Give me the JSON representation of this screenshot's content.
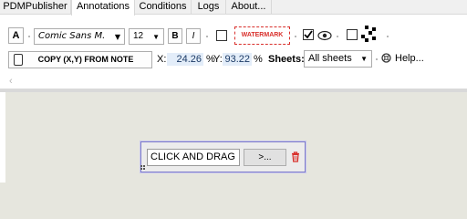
{
  "tabs": [
    {
      "label": "PDMPublisher",
      "active": false
    },
    {
      "label": "Annotations",
      "active": true
    },
    {
      "label": "Conditions",
      "active": false
    },
    {
      "label": "Logs",
      "active": false
    },
    {
      "label": "About...",
      "active": false
    }
  ],
  "toolbar": {
    "text_button_label": "A",
    "font_name": "Comic Sans M.",
    "font_size": "12",
    "bold_label": "B",
    "italic_label": "I",
    "watermark_label": "WATERMARK",
    "watermark_checked": false,
    "visibility_checked": true,
    "qr_checked": false,
    "copy_button_label": "COPY (X,Y) FROM NOTE",
    "x_label": "X:",
    "x_value": "24.26",
    "x_unit": "%",
    "y_label": "Y:",
    "y_value": "93.22",
    "y_unit": "%",
    "sheets_label": "Sheets:",
    "sheets_value": "All sheets",
    "help_label": "Help..."
  },
  "nav": {
    "back_glyph": "‹"
  },
  "widget": {
    "text_value": "CLICK AND DRAG",
    "action_label": ">..."
  },
  "colors": {
    "watermark_red": "#d9302c",
    "widget_border": "#7d7bc9",
    "delete_red": "#d9302c",
    "value_highlight": "#e3edf9"
  },
  "icons": {
    "visibility": "eye-icon",
    "qr": "qr-code-icon",
    "help": "help-lifebuoy-icon",
    "delete": "trash-icon",
    "drag": "drag-grip-icon"
  }
}
